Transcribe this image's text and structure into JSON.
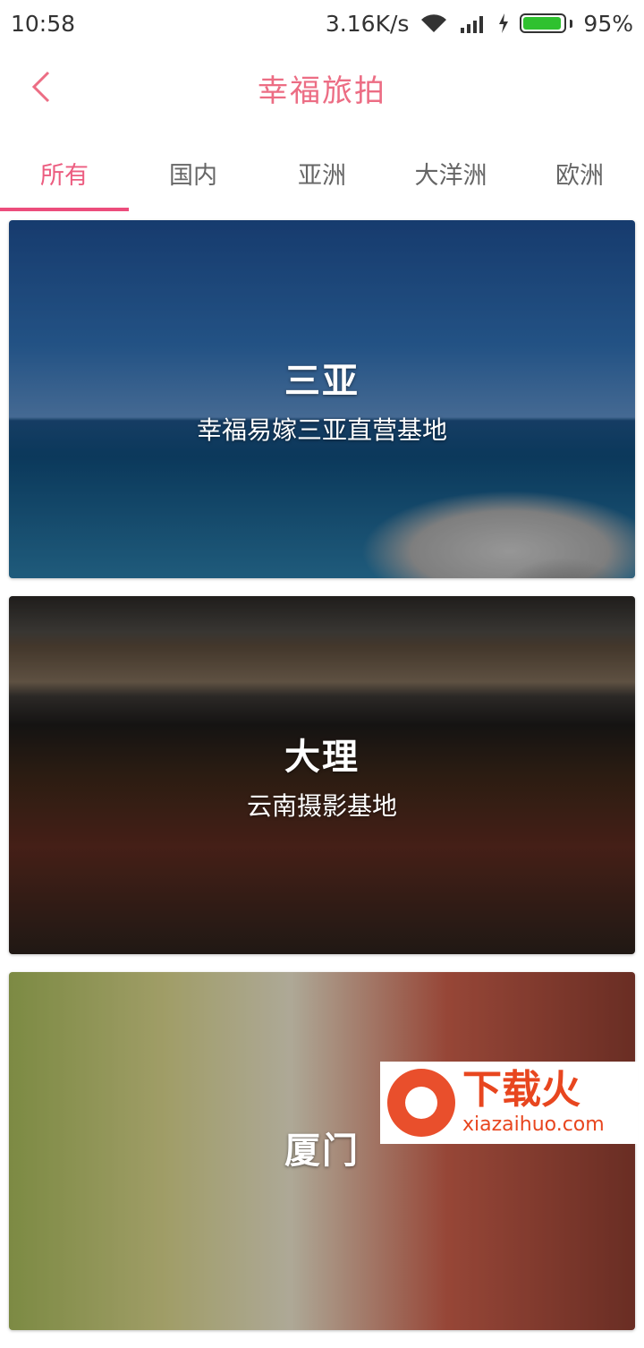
{
  "status": {
    "time": "10:58",
    "speed": "3.16K/s",
    "battery": "95%",
    "battery_level": 0.95
  },
  "header": {
    "title": "幸福旅拍",
    "back_icon": "chevron-left-icon"
  },
  "tabs": [
    {
      "label": "所有",
      "active": true
    },
    {
      "label": "国内",
      "active": false
    },
    {
      "label": "亚洲",
      "active": false
    },
    {
      "label": "大洋洲",
      "active": false
    },
    {
      "label": "欧洲",
      "active": false
    }
  ],
  "destinations": [
    {
      "title": "三亚",
      "subtitle": "幸福易嫁三亚直营基地"
    },
    {
      "title": "大理",
      "subtitle": "云南摄影基地"
    },
    {
      "title": "厦门",
      "subtitle": ""
    }
  ],
  "watermark": {
    "main": "下载火",
    "sub": "xiazaihuo.com"
  },
  "colors": {
    "accent": "#ec4d7c",
    "title": "#ec6d84"
  }
}
